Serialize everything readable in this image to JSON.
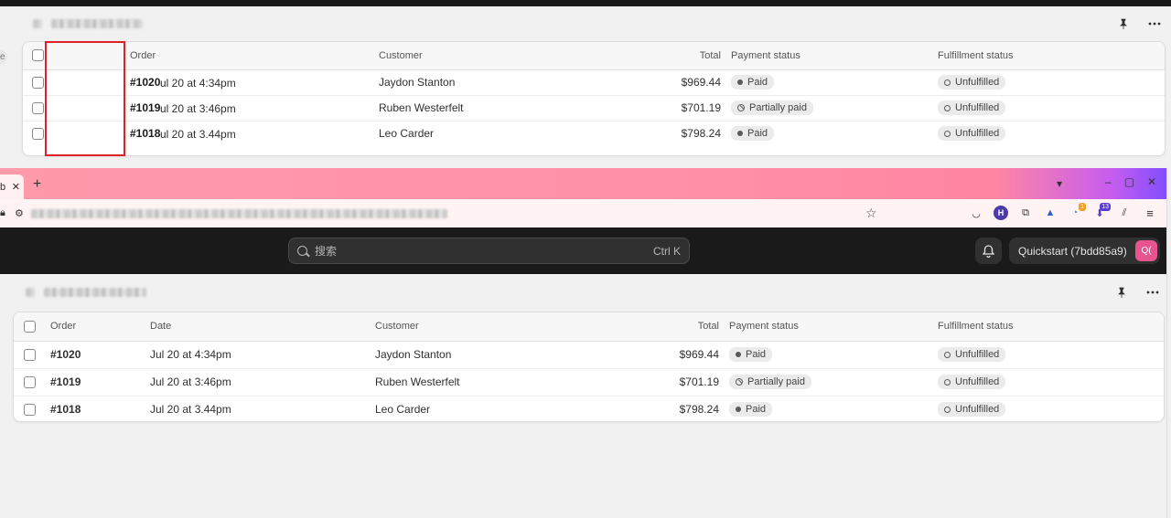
{
  "top_panel": {
    "columns": {
      "order": "Order",
      "customer": "Customer",
      "total": "Total",
      "payment": "Payment status",
      "fulfillment": "Fulfillment status"
    },
    "rows": [
      {
        "order": "#1020",
        "date_overlap": "ul 20 at 4:34pm",
        "customer": "Jaydon Stanton",
        "total": "$969.44",
        "payment": "Paid",
        "fulfillment": "Unfulfilled"
      },
      {
        "order": "#1019",
        "date_overlap": "ul 20 at 3:46pm",
        "customer": "Ruben Westerfelt",
        "total": "$701.19",
        "payment": "Partially paid",
        "fulfillment": "Unfulfilled"
      },
      {
        "order": "#1018",
        "date_overlap": "ul 20 at 3.44pm",
        "customer": "Leo Carder",
        "total": "$798.24",
        "payment": "Paid",
        "fulfillment": "Unfulfilled"
      }
    ],
    "highlight_color": "#e0202a"
  },
  "left_edge_char": "e",
  "browser": {
    "tab_fragment": "b",
    "tab_close": "✕",
    "new_tab": "+",
    "window_controls": [
      "–",
      "▢",
      "✕"
    ],
    "gradient_colors": [
      "#ff9aab",
      "#ff86a3",
      "#7a4dff"
    ],
    "extensions": [
      {
        "icon": "pocket-icon",
        "glyph": "◡"
      },
      {
        "icon": "h-extension-icon",
        "glyph": "H"
      },
      {
        "icon": "puzzle-icon",
        "glyph": "⧉"
      },
      {
        "icon": "triangle-extension-icon",
        "glyph": "▲"
      },
      {
        "icon": "badge-extension-icon",
        "glyph": "◔",
        "badge": "1"
      },
      {
        "icon": "download-extension-icon",
        "glyph": "⬇",
        "badge": "13"
      },
      {
        "icon": "library-icon",
        "glyph": "⫽"
      },
      {
        "icon": "menu-icon",
        "glyph": "≡"
      }
    ]
  },
  "app_header": {
    "search_placeholder": "搜索",
    "search_shortcut": "Ctrl K",
    "store_name": "Quickstart (7bdd85a9)",
    "avatar_initials": "Q("
  },
  "orders": {
    "columns": {
      "order": "Order",
      "date": "Date",
      "customer": "Customer",
      "total": "Total",
      "payment": "Payment status",
      "fulfillment": "Fulfillment status"
    },
    "rows": [
      {
        "order": "#1020",
        "date": "Jul 20 at 4:34pm",
        "customer": "Jaydon Stanton",
        "total": "$969.44",
        "payment": "Paid",
        "fulfillment": "Unfulfilled"
      },
      {
        "order": "#1019",
        "date": "Jul 20 at 3:46pm",
        "customer": "Ruben Westerfelt",
        "total": "$701.19",
        "payment": "Partially paid",
        "fulfillment": "Unfulfilled"
      },
      {
        "order": "#1018",
        "date": "Jul 20 at 3.44pm",
        "customer": "Leo Carder",
        "total": "$798.24",
        "payment": "Paid",
        "fulfillment": "Unfulfilled"
      }
    ]
  }
}
